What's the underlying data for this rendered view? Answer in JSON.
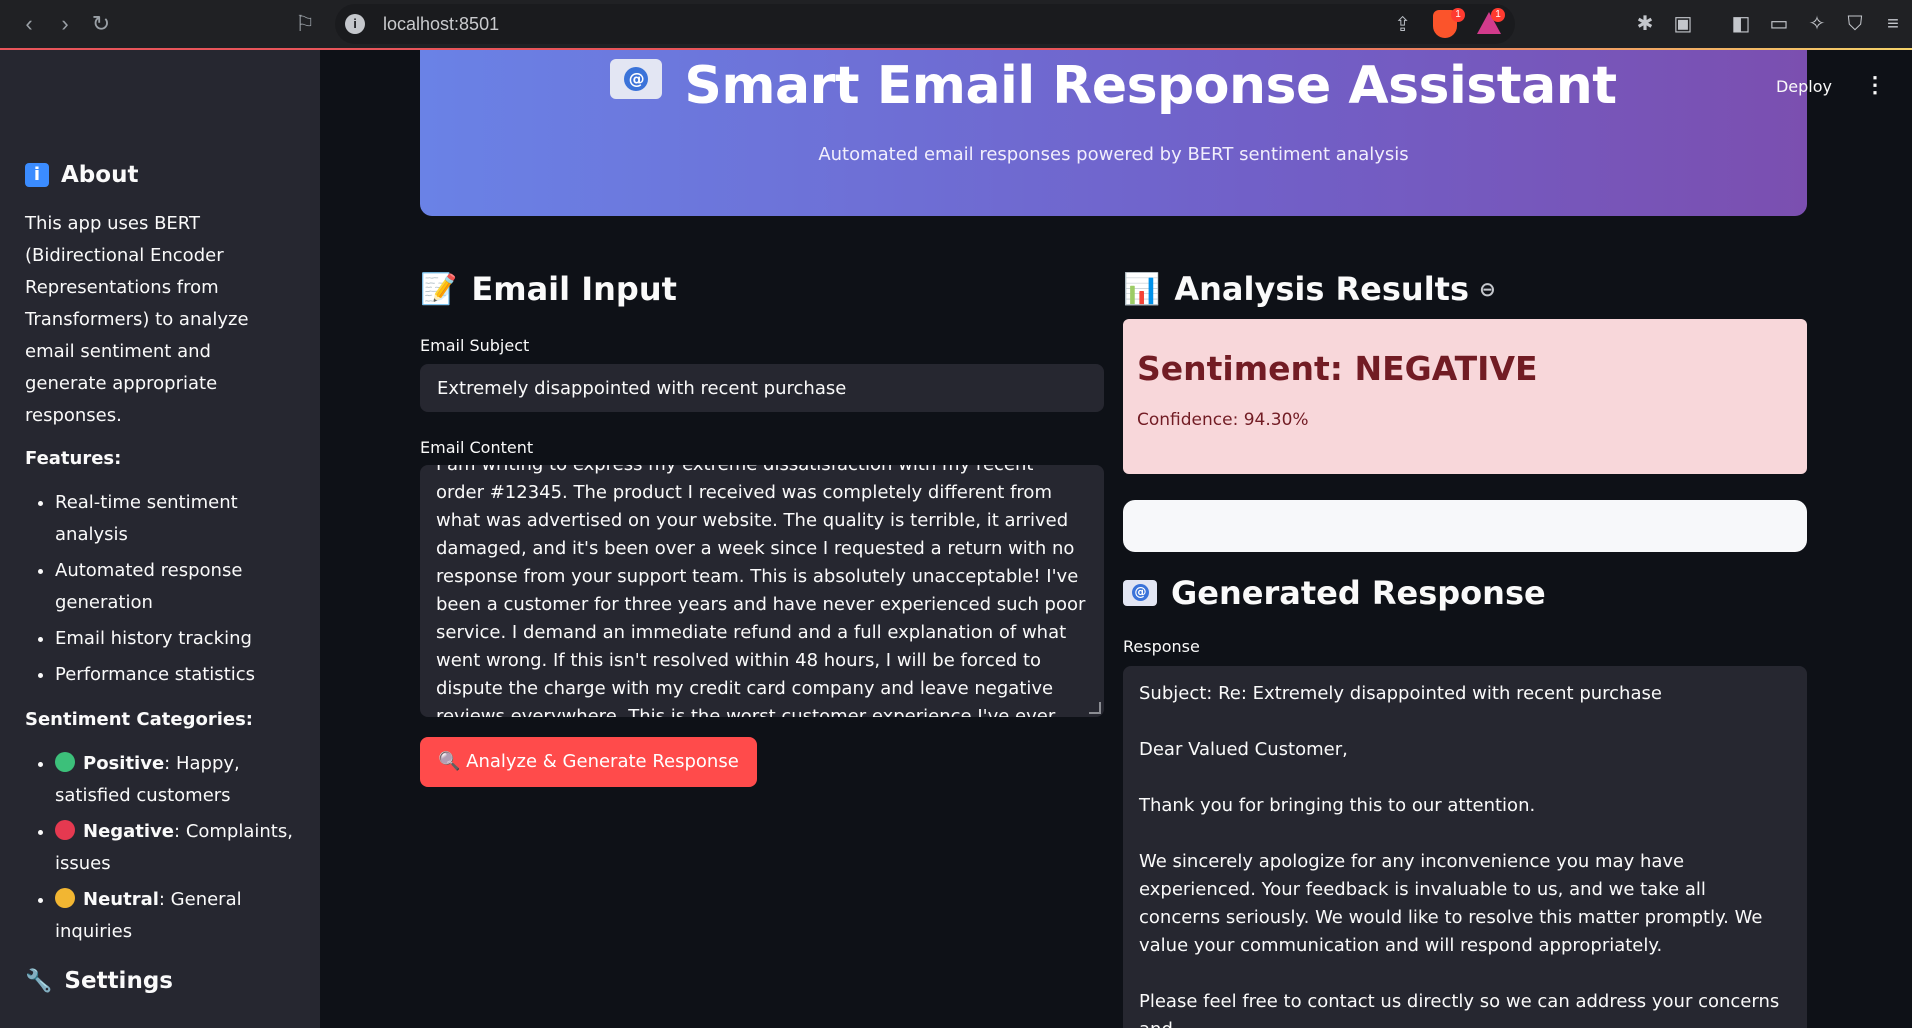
{
  "browser": {
    "url": "localhost:8501",
    "brave_badge": "1",
    "rewards_badge": "1"
  },
  "toolbar": {
    "deploy_label": "Deploy",
    "menu_glyph": "⋮"
  },
  "sidebar": {
    "about_heading": "About",
    "about_text": "This app uses BERT (Bidirectional Encoder Representations from Transformers) to analyze email sentiment and generate appropriate responses.",
    "features_heading": "Features:",
    "features": [
      "Real-time sentiment analysis",
      "Automated response generation",
      "Email history tracking",
      "Performance statistics"
    ],
    "categories_heading": "Sentiment Categories:",
    "categories": [
      {
        "name": "Positive",
        "desc": ": Happy, satisfied customers",
        "color": "#3cc07a"
      },
      {
        "name": "Negative",
        "desc": ": Complaints, issues",
        "color": "#e53950"
      },
      {
        "name": "Neutral",
        "desc": ": General inquiries",
        "color": "#f2b632"
      }
    ],
    "settings_heading": "Settings"
  },
  "header": {
    "title": "Smart Email Response Assistant",
    "subtitle": "Automated email responses powered by BERT sentiment analysis"
  },
  "input": {
    "heading": "Email Input",
    "subject_label": "Email Subject",
    "subject_value": "Extremely disappointed with recent purchase",
    "content_label": "Email Content",
    "content_value": "I am writing to express my extreme dissatisfaction with my recent order #12345. The product I received was completely different from what was advertised on your website. The quality is terrible, it arrived damaged, and it's been over a week since I requested a return with no response from your support team. This is absolutely unacceptable! I've been a customer for three years and have never experienced such poor service. I demand an immediate refund and a full explanation of what went wrong. If this isn't resolved within 48 hours, I will be forced to dispute the charge with my credit card company and leave negative reviews everywhere. This is the worst customer experience I've ever had!",
    "analyze_button": "🔍 Analyze & Generate Response"
  },
  "results": {
    "heading": "Analysis Results",
    "sentiment_label": "Sentiment: NEGATIVE",
    "confidence_label": "Confidence: 94.30%",
    "colors": {
      "box_bg": "#f8d7da",
      "text": "#721c24"
    }
  },
  "response": {
    "heading": "Generated Response",
    "label": "Response",
    "paragraphs": [
      "Subject: Re: Extremely disappointed with recent purchase",
      "Dear Valued Customer,",
      "Thank you for bringing this to our attention.",
      "We sincerely apologize for any inconvenience you may have experienced. Your feedback is invaluable to us, and we take all concerns seriously. We would like to resolve this matter promptly. We value your communication and will respond appropriately.",
      "Please feel free to contact us directly so we can address your concerns and"
    ]
  },
  "colors": {
    "accent": "#ff4b4b",
    "sidebar_bg": "#262730",
    "app_bg": "#0e1117"
  }
}
